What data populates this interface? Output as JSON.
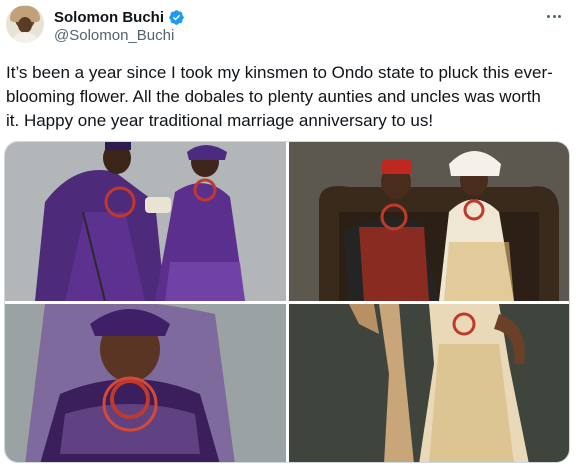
{
  "author": {
    "display_name": "Solomon Buchi",
    "handle": "@Solomon_Buchi",
    "verified": true
  },
  "tweet": {
    "text_lines": [
      "It’s been a year since I took my kinsmen to Ondo state to pluck this ever-",
      "blooming flower. All the dobales to plenty aunties and uncles was worth",
      "it. Happy one year traditional marriage anniversary to us!"
    ]
  },
  "media": {
    "count": 4
  },
  "icons": {
    "verified": "verified-badge-icon",
    "more": "more-options-icon"
  },
  "colors": {
    "accent_blue": "#1d9bf0",
    "text_primary": "#0f1419",
    "text_secondary": "#536471"
  }
}
